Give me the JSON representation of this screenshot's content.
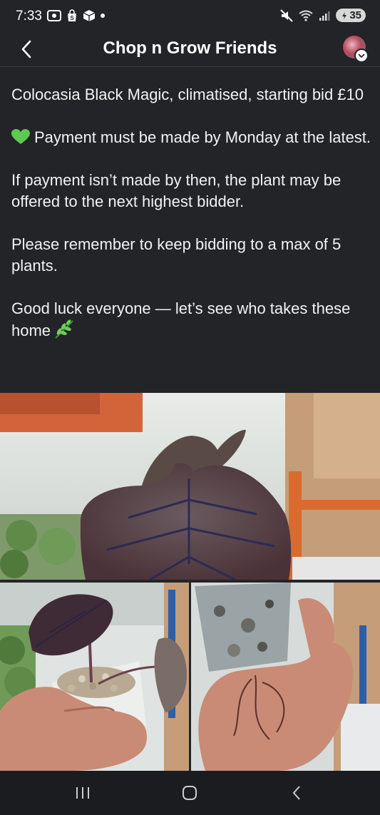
{
  "status_bar": {
    "time": "7:33",
    "battery": "35",
    "icons": [
      "screenshot-icon",
      "shopping-bag-icon",
      "package-icon",
      "dot-icon",
      "mute-icon",
      "wifi-icon",
      "signal-icon",
      "battery-icon"
    ]
  },
  "header": {
    "title": "Chop n Grow Friends",
    "back_icon": "chevron-left-icon"
  },
  "post": {
    "paragraphs": [
      "Colocasia Black Magic, climatised, starting bid £10",
      "Payment must be made by Monday at the latest.",
      "If payment isn’t made by then, the plant may be offered to the next highest bidder.",
      "Please remember to keep bidding to a max of 5 plants.",
      "Good luck everyone — let’s see who takes these home"
    ],
    "emoji": {
      "heart": "green-heart-icon",
      "herb": "herb-icon"
    }
  },
  "photos": [
    {
      "name": "plant-photo-main",
      "subject": "Colocasia Black Magic leaf"
    },
    {
      "name": "plant-photo-pot",
      "subject": "plant in pot"
    },
    {
      "name": "plant-photo-roots",
      "subject": "roots"
    }
  ],
  "nav_bar": {
    "icons": [
      "recents-icon",
      "home-icon",
      "back-icon"
    ]
  },
  "colors": {
    "background": "#232428",
    "text": "#f2f2f2",
    "nav": "#1b1c1f",
    "accent_green": "#4caf50"
  }
}
